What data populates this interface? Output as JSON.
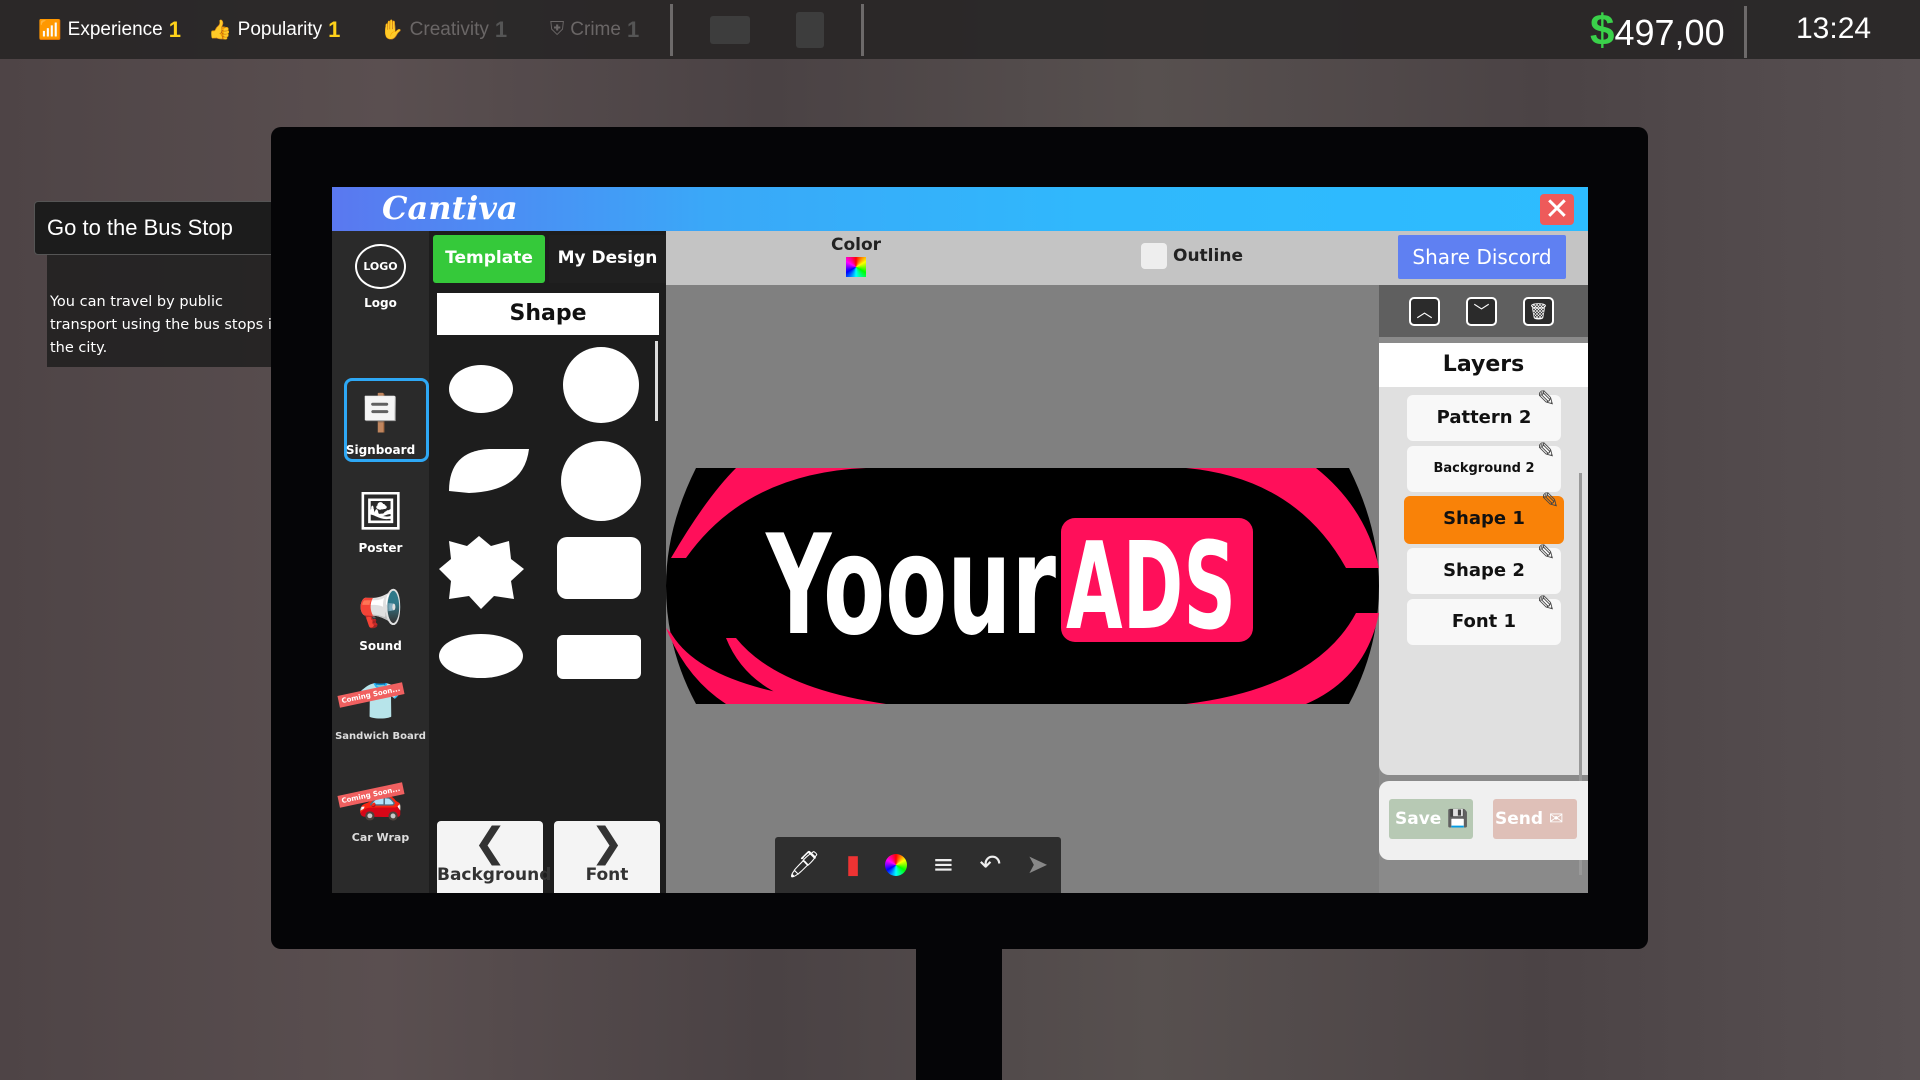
{
  "hud": {
    "stats": [
      {
        "label": "Experience",
        "level": "1",
        "active": true
      },
      {
        "label": "Popularity",
        "level": "1",
        "active": true
      },
      {
        "label": "Creativity",
        "level": "1",
        "active": false
      },
      {
        "label": "Crime",
        "level": "1",
        "active": false
      }
    ],
    "money_symbol": "$",
    "money": "497,00",
    "time": "13:24"
  },
  "mission": {
    "title": "Go to the Bus Stop",
    "description": "You can travel by public transport using the bus stops in the city."
  },
  "app": {
    "name": "Cantiva",
    "sidebar": [
      {
        "label": "Logo",
        "icon": "logo-icon"
      },
      {
        "label": "Signboard",
        "icon": "signboard-icon",
        "selected": true
      },
      {
        "label": "Poster",
        "icon": "poster-icon"
      },
      {
        "label": "Sound",
        "icon": "megaphone-icon"
      },
      {
        "label": "Sandwich Board",
        "icon": "sandwich-board-icon",
        "badge": "Coming Soon..."
      },
      {
        "label": "Car Wrap",
        "icon": "car-icon",
        "badge": "Coming Soon..."
      }
    ],
    "tabs": {
      "template": "Template",
      "my_design": "My Design"
    },
    "panel_title": "Shape",
    "nav": {
      "prev": "Background",
      "next": "Font"
    },
    "toolbar": {
      "color_label": "Color",
      "outline_label": "Outline",
      "outline_checked": false
    },
    "share_button": "Share Discord",
    "design": {
      "text_main": "Yoour",
      "text_highlight": "ADS",
      "colors": {
        "accent": "#ff0f5a",
        "bg": "#000000",
        "text": "#ffffff"
      }
    },
    "layers": {
      "title": "Layers",
      "items": [
        "Pattern 2",
        "Background 2",
        "Shape 1",
        "Shape 2",
        "Font 1"
      ],
      "selected": "Shape 1"
    },
    "save": "Save",
    "send": "Send",
    "colors": {
      "template_tab": "#35c93a",
      "selected_layer": "#f98208",
      "share": "#5f80f2",
      "close": "#ee5a5a"
    }
  }
}
